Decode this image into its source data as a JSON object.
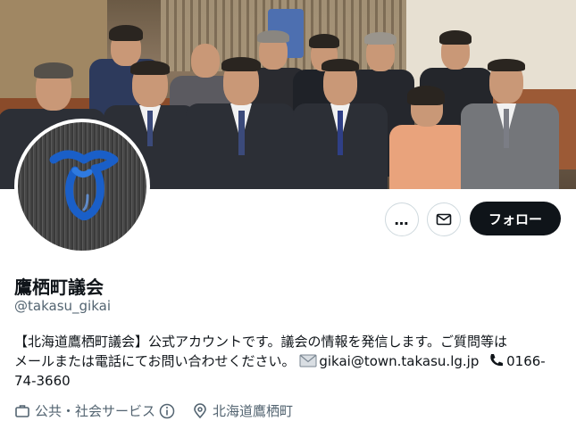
{
  "header": {
    "banner": "group-photo-council-members"
  },
  "avatar": {
    "icon": "ribbon-emblem-icon",
    "accent": "#1a5fc8"
  },
  "actions": {
    "more_label": "…",
    "message_icon": "mail-icon",
    "follow_label": "フォロー"
  },
  "profile": {
    "name": "鷹栖町議会",
    "handle": "@takasu_gikai",
    "bio_line1": "【北海道鷹栖町議会】公式アカウントです。議会の情報を発信します。ご質問等は",
    "bio_line2_text": "メールまたは電話にてお問い合わせください。",
    "email": "gikai@town.takasu.lg.jp",
    "phone_part1": "0166-",
    "phone_part2": "74-3660",
    "category": "公共・社会サービス",
    "location": "北海道鷹栖町"
  },
  "colors": {
    "follow_bg": "#0f1419",
    "secondary_text": "#536471",
    "border": "#cfd9de"
  }
}
